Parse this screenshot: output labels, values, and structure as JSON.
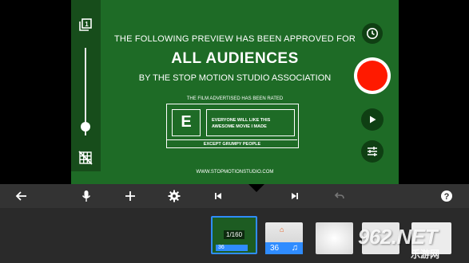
{
  "preview": {
    "line1": "THE FOLLOWING PREVIEW HAS BEEN APPROVED FOR",
    "headline": "ALL AUDIENCES",
    "line3": "BY THE STOP MOTION STUDIO ASSOCIATION",
    "rated_label": "THE FILM ADVERTISED HAS BEEN RATED",
    "rating_letter": "E",
    "rating_desc_1": "EVERYONE WILL LIKE THIS",
    "rating_desc_2": "AWESOME MOVIE I MADE",
    "rating_foot": "EXCEPT GRUMPY PEOPLE",
    "url": "WWW.STOPMOTIONSTUDIO.COM",
    "background_color": "#1e6b26"
  },
  "left_rail": {
    "top_icon": "layers-one-icon",
    "bottom_icon": "grid-off-icon",
    "slider_level": 0.9
  },
  "right_controls": {
    "clock_icon": "clock-icon",
    "record_color": "#ff1a00",
    "play_icon": "play-icon",
    "adjust_icon": "sliders-icon"
  },
  "toolbar": {
    "icons": [
      "back-arrow-icon",
      "microphone-icon",
      "plus-icon",
      "gear-icon",
      "skip-start-icon",
      "skip-end-icon",
      "undo-icon",
      "help-icon"
    ]
  },
  "timeline": {
    "frame_counter": "1/160",
    "frame_1_bar": "36",
    "frame_2_count": "36",
    "frame_2_note": "♫",
    "accent": "#2f8cff"
  },
  "watermark": {
    "main": "962.NET",
    "sub": "乐游网"
  }
}
